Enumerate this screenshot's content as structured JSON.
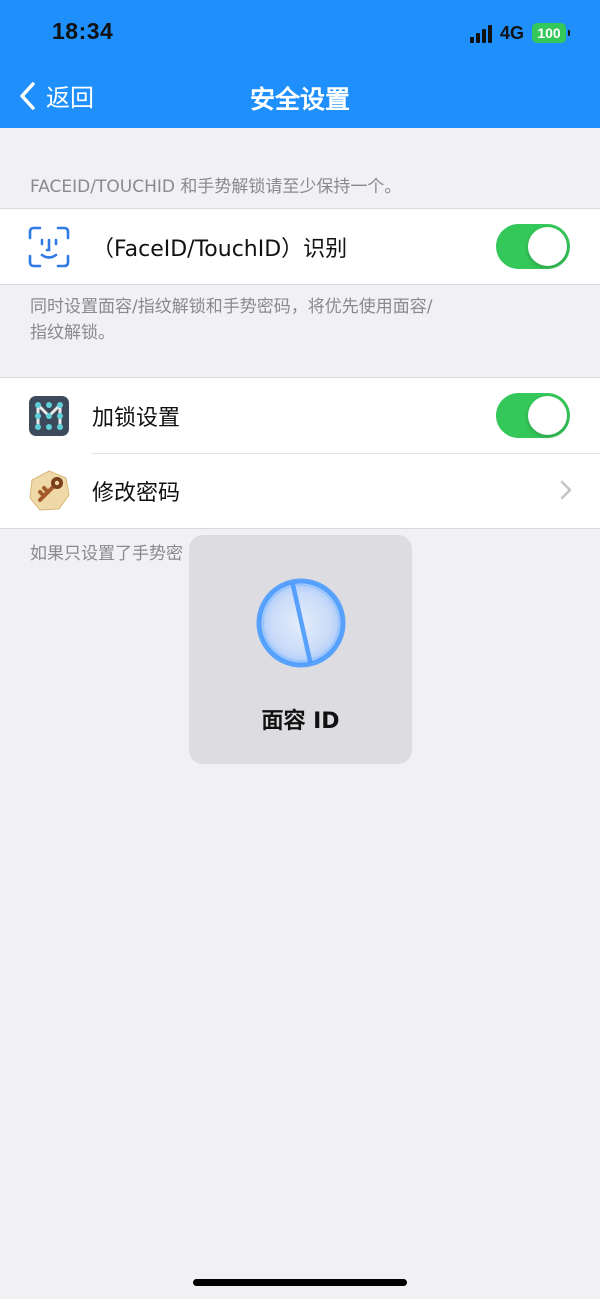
{
  "status_bar": {
    "time": "18:34",
    "network": "4G",
    "battery": "100"
  },
  "nav": {
    "back_label": "返回",
    "title": "安全设置"
  },
  "faceid_section": {
    "note": "FACEID/TOUCHID 和手势解锁请至少保持一个。",
    "row_label": "（FaceID/TouchID）识别",
    "toggle_on": true,
    "footer_note_line1": "同时设置面容/指纹解锁和手势密码，将优先使用面容/",
    "footer_note_line2": "指纹解锁。"
  },
  "lock_section": {
    "lock_label": "加锁设置",
    "lock_toggle_on": true,
    "change_password_label": "修改密码",
    "footer_note": "如果只设置了手势密"
  },
  "hud": {
    "label": "面容 ID"
  },
  "colors": {
    "header": "#1e8ffb",
    "toggle": "#34c759",
    "background": "#f0f0f5"
  },
  "icons": [
    "chevron-left-icon",
    "face-id-icon",
    "pattern-lock-icon",
    "key-icon",
    "chevron-right-icon"
  ]
}
